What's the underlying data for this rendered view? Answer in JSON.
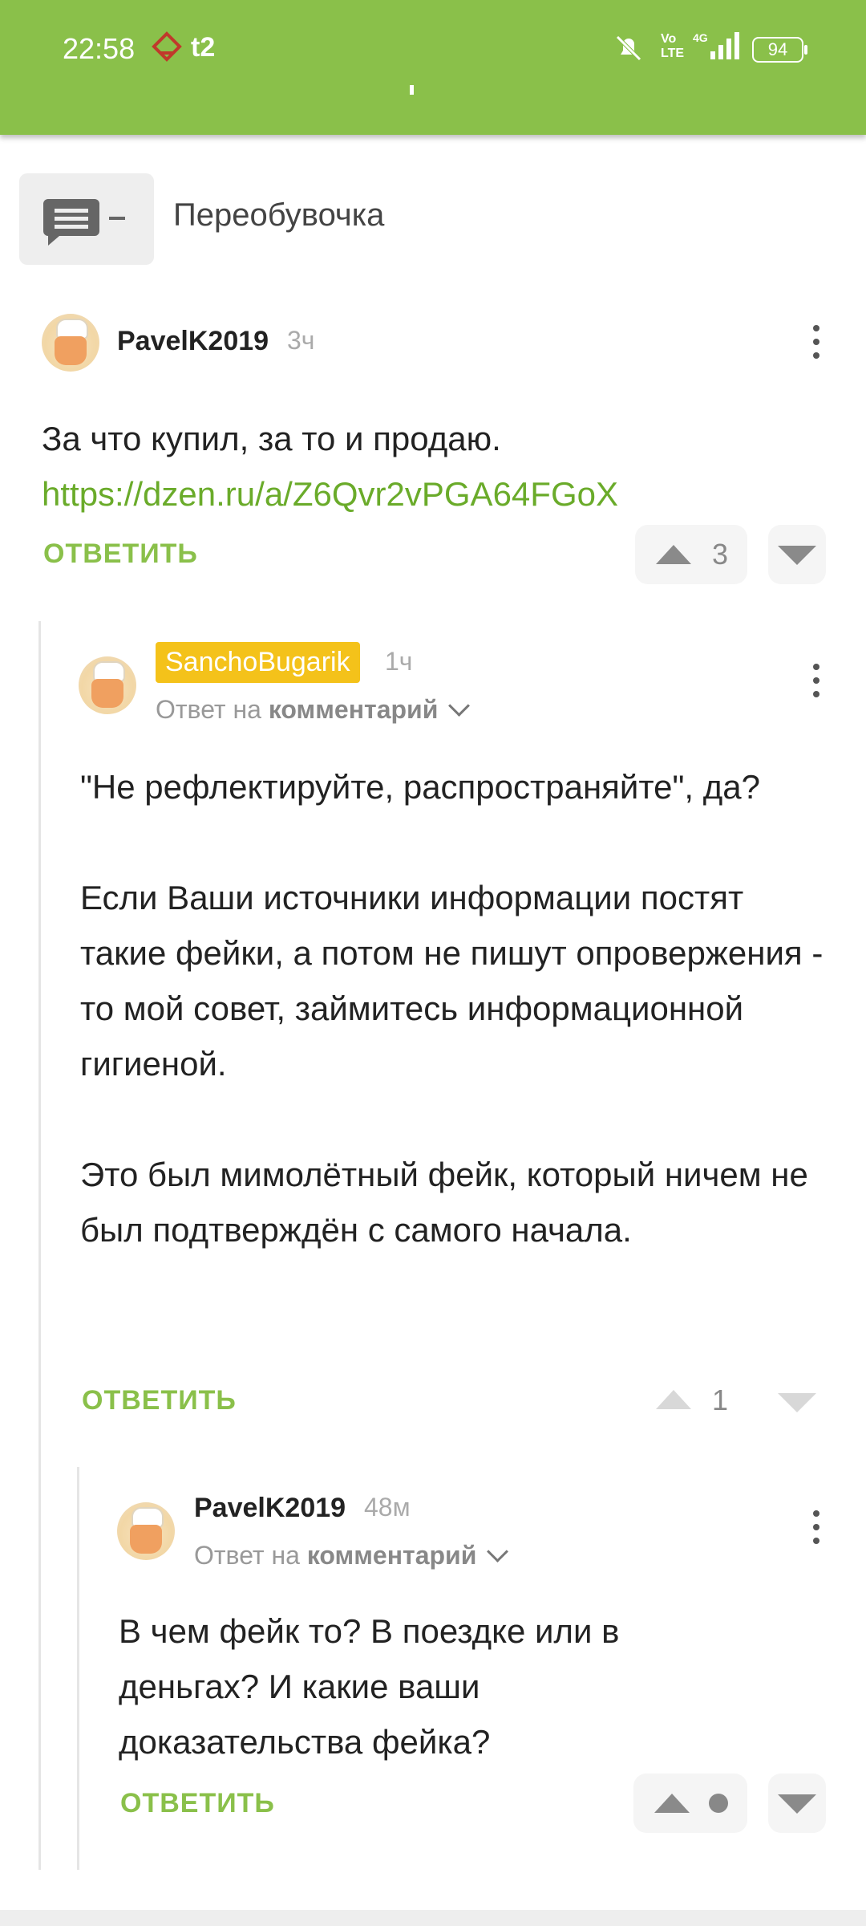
{
  "status_bar": {
    "time": "22:58",
    "carrier": "t2",
    "battery": "94",
    "icons": [
      "app-notification-icon",
      "mute-icon",
      "volte-icon",
      "signal-4g-icon"
    ]
  },
  "post": {
    "title": "Переобувочка",
    "icon": "comments-icon"
  },
  "comments": [
    {
      "author": "PavelK2019",
      "time": "3ч",
      "text": "За что купил, за то и продаю.",
      "link": "https://dzen.ru/a/Z6Qvr2vPGA64FGoX",
      "reply_label": "ОТВЕТИТЬ",
      "rating": "3"
    },
    {
      "author": "SanchoBugarik",
      "time": "1ч",
      "reply_to_prefix": "Ответ на",
      "reply_to_target": "комментарий",
      "paragraphs": [
        "\"Не рефлектируйте, распространяйте\", да?",
        "Если Ваши источники информации постят такие фейки, а потом не пишут опровержения - то мой совет, займитесь информационной гигиеной.",
        "Это был мимолётный фейк, который ничем не был подтверждён с самого начала."
      ],
      "reply_label": "ОТВЕТИТЬ",
      "rating": "1"
    },
    {
      "author": "PavelK2019",
      "time": "48м",
      "reply_to_prefix": "Ответ на",
      "reply_to_target": "комментарий",
      "text": "В чем фейк то? В поездке или в деньгах? И какие ваши доказательства фейка?",
      "reply_label": "ОТВЕТИТЬ"
    }
  ],
  "colors": {
    "accent": "#8ac04a",
    "badge": "#f4c21a",
    "link": "#6aab2a"
  }
}
